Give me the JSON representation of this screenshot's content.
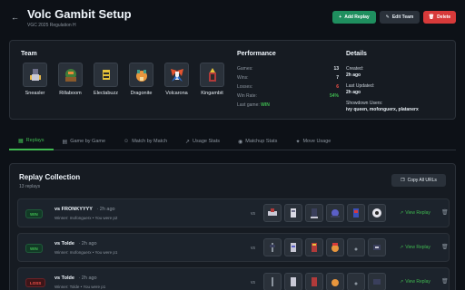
{
  "header": {
    "title": "Volc Gambit Setup",
    "subtitle": "VGC 2025 Regulation H",
    "add_replay": "Add Replay",
    "edit_team": "Edit Team",
    "delete": "Delete"
  },
  "team": {
    "title": "Team",
    "members": [
      "Sneasler",
      "Rillaboom",
      "Electabuzz",
      "Dragonite",
      "Volcarona",
      "Kingambit"
    ]
  },
  "performance": {
    "title": "Performance",
    "games_label": "Games:",
    "games": "13",
    "wins_label": "Wins:",
    "wins": "7",
    "losses_label": "Losses:",
    "losses": "6",
    "winrate_label": "Win Rate:",
    "winrate": "54%",
    "lastgame_label": "Last game:",
    "lastgame": "WIN"
  },
  "details": {
    "title": "Details",
    "created_label": "Created:",
    "created": "2h ago",
    "updated_label": "Last Updated:",
    "updated": "2h ago",
    "users_label": "Showdown Users:",
    "users": "ivy queen, mofonguerx, platanerx"
  },
  "tabs": [
    "Replays",
    "Game by Game",
    "Match by Match",
    "Usage Stats",
    "Matchup Stats",
    "Move Usage"
  ],
  "replays": {
    "title": "Replay Collection",
    "count": "13 replays",
    "copy_all": "Copy All URLs",
    "vs_label": "vs",
    "view_label": "View Replay",
    "rows": [
      {
        "result": "WIN",
        "opponent": "vs FRONKYYYY",
        "time": "2h ago",
        "winner": "Winner: mofonguerx • You were p2"
      },
      {
        "result": "WIN",
        "opponent": "vs Tolde",
        "time": "2h ago",
        "winner": "Winner: mofonguerx • You were p1"
      },
      {
        "result": "LOSS",
        "opponent": "vs Tolde",
        "time": "2h ago",
        "winner": "Winner: Tolde • You were p1"
      }
    ]
  },
  "colors": {
    "accent": "#3fb950",
    "danger": "#d73a3a",
    "add": "#1f8f5f",
    "bg": "#0d1117",
    "card": "#161b22"
  }
}
